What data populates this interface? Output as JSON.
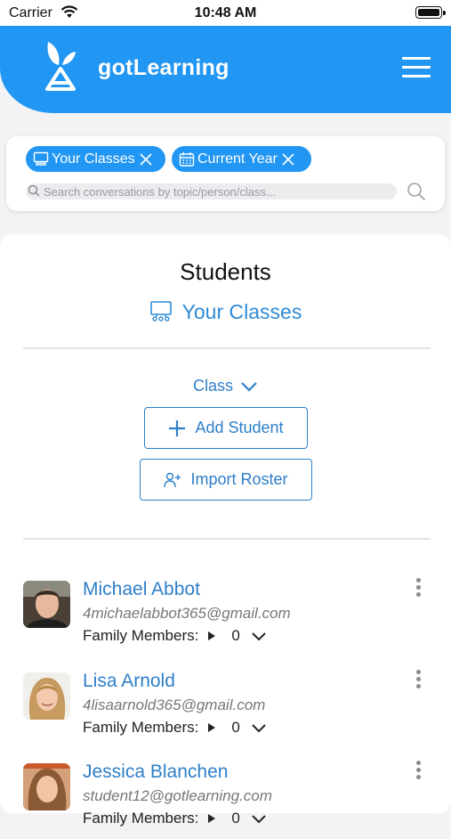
{
  "status_bar": {
    "carrier": "Carrier",
    "time": "10:48 AM"
  },
  "header": {
    "app_title": "gotLearning"
  },
  "filters": {
    "chips": [
      {
        "label": "Your Classes",
        "icon": "classroom-icon"
      },
      {
        "label": "Current Year",
        "icon": "calendar-icon"
      }
    ],
    "search_placeholder": "Search conversations by topic/person/class..."
  },
  "main": {
    "title": "Students",
    "context_label": "Your Classes",
    "class_dropdown_label": "Class",
    "add_student_label": "Add Student",
    "import_roster_label": "Import Roster"
  },
  "students": [
    {
      "name": "Michael Abbot",
      "email": "4michaelabbot365@gmail.com",
      "family_label": "Family Members:",
      "family_count": "0"
    },
    {
      "name": "Lisa Arnold",
      "email": "4lisaarnold365@gmail.com",
      "family_label": "Family Members:",
      "family_count": "0"
    },
    {
      "name": "Jessica Blanchen",
      "email": "student12@gotlearning.com",
      "family_label": "Family Members:",
      "family_count": "0"
    }
  ],
  "colors": {
    "brand_blue": "#2196f3",
    "link_blue": "#2e7fc9"
  }
}
